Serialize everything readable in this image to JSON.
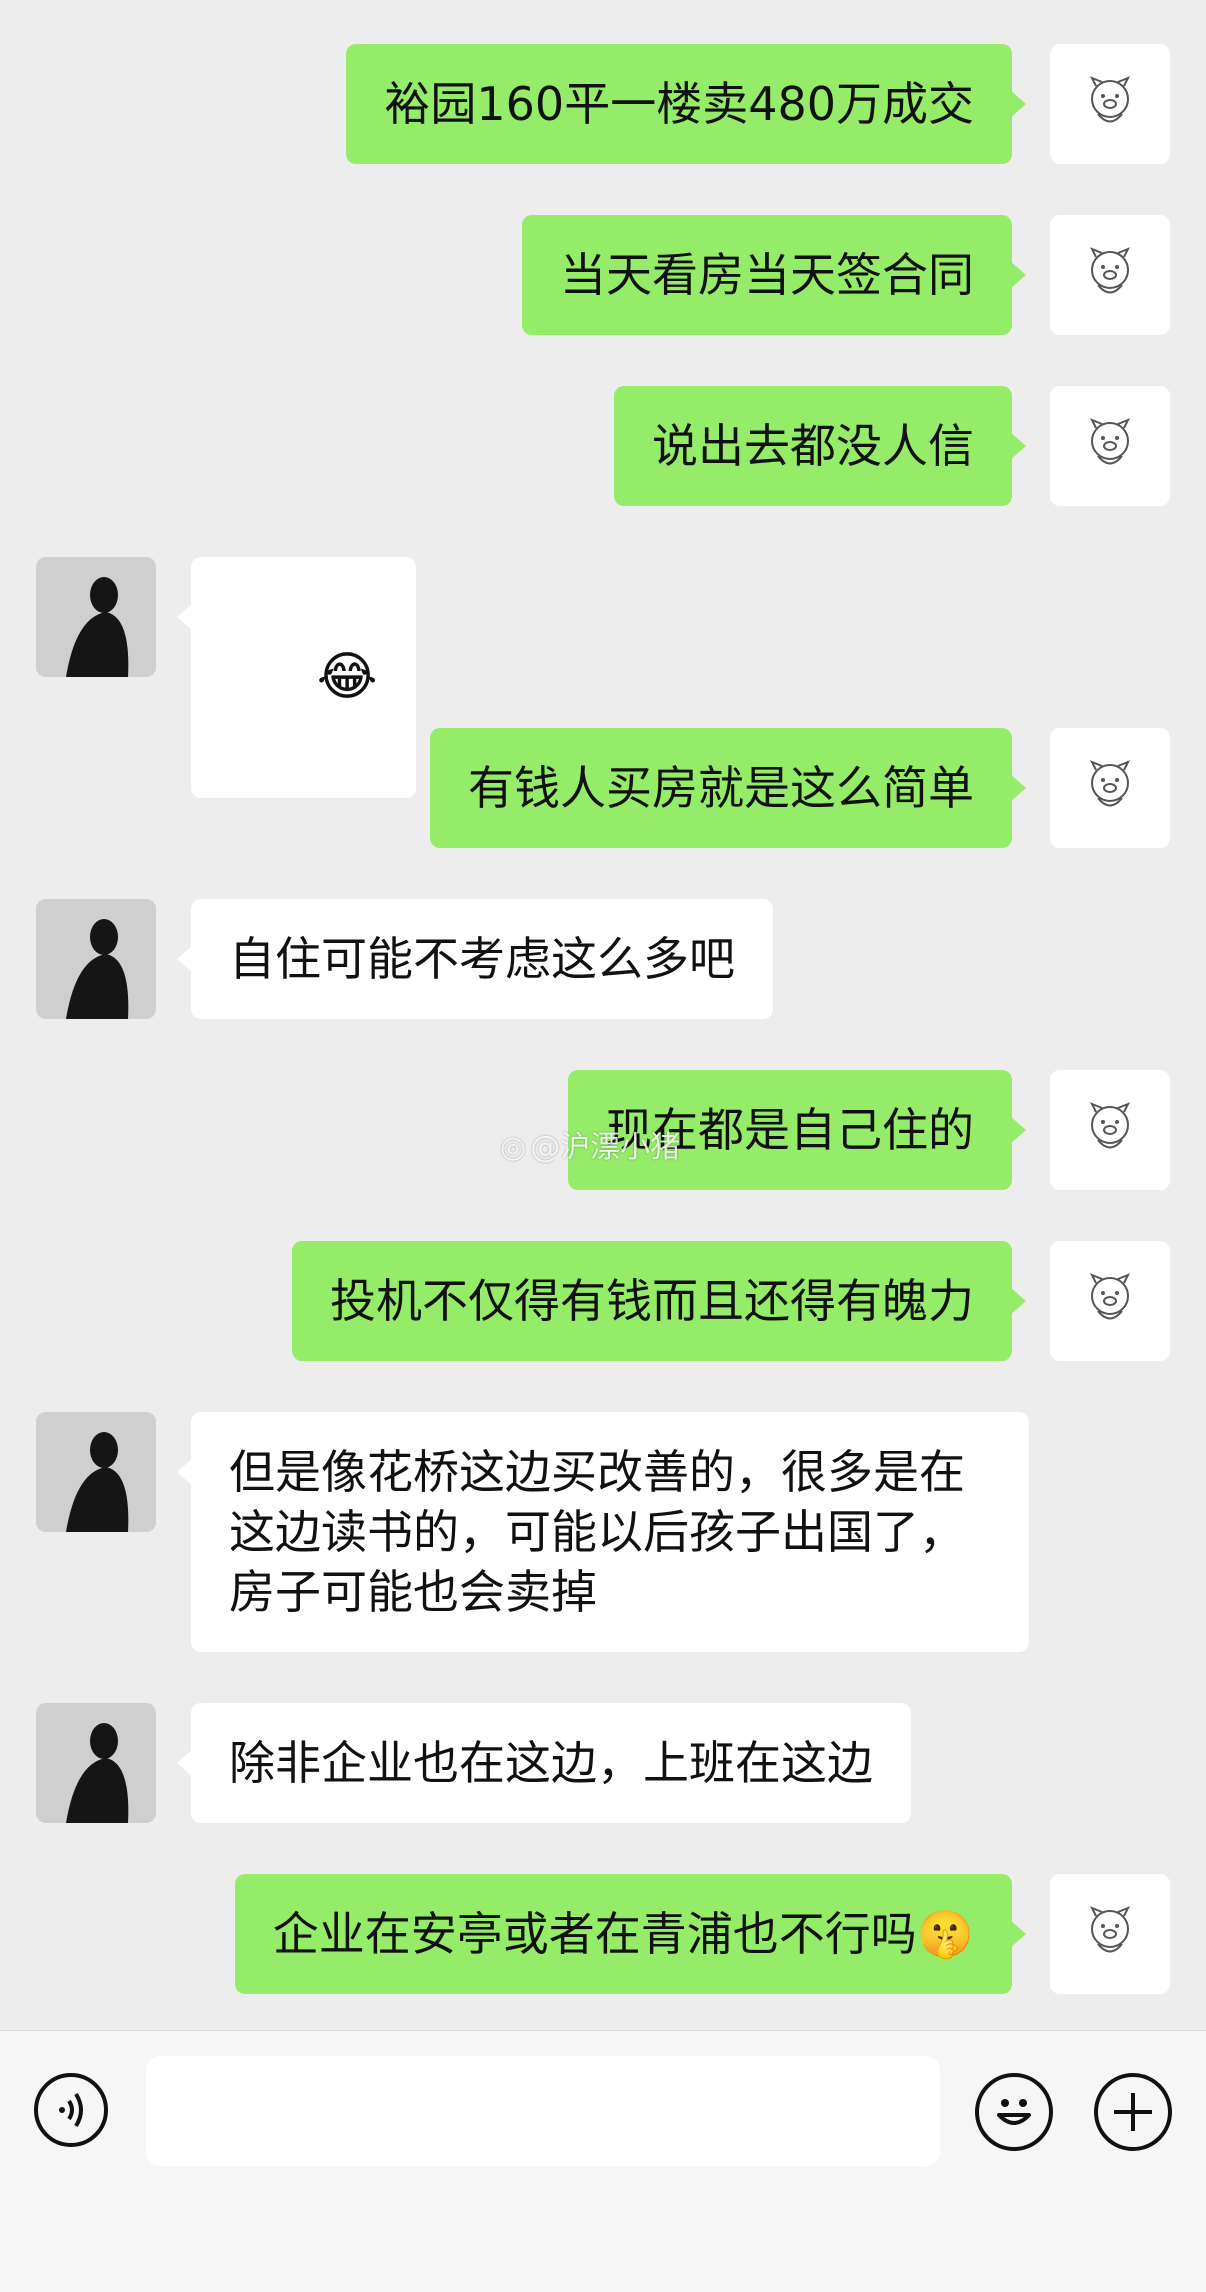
{
  "watermark": "@沪漂小猪",
  "messages": [
    {
      "side": "me",
      "text": "裕园160平一楼卖480万成交"
    },
    {
      "side": "me",
      "text": "当天看房当天签合同"
    },
    {
      "side": "me",
      "text": "说出去都没人信"
    },
    {
      "side": "them",
      "text": "😂"
    },
    {
      "side": "me",
      "text": "有钱人买房就是这么简单"
    },
    {
      "side": "them",
      "text": "自住可能不考虑这么多吧"
    },
    {
      "side": "me",
      "text": "现在都是自己住的"
    },
    {
      "side": "me",
      "text": "投机不仅得有钱而且还得有魄力"
    },
    {
      "side": "them",
      "text": "但是像花桥这边买改善的，很多是在\n这边读书的，可能以后孩子出国了，\n房子可能也会卖掉"
    },
    {
      "side": "them",
      "text": "除非企业也在这边，上班在这边"
    },
    {
      "side": "me",
      "text": "企业在安亭或者在青浦也不行吗🤫"
    }
  ],
  "icons": {
    "voice": "voice-icon",
    "emoji": "emoji-icon",
    "plus": "plus-icon"
  }
}
